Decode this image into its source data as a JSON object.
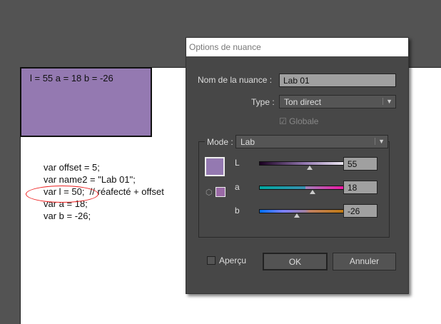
{
  "canvas": {
    "swatch_text": "l = 55 a = 18 b = -26",
    "swatch_color": "#9479b1",
    "code_lines": [
      "var offset = 5;",
      "var name2 = \"Lab 01\";",
      "var l = 50;  // réafecté + offset",
      "var a = 18;",
      "var b = -26;"
    ]
  },
  "dialog": {
    "title": "Options de nuance",
    "name_label": "Nom de la nuance :",
    "name_value": "Lab 01",
    "type_label": "Type :",
    "type_value": "Ton direct",
    "global_label": "Globale",
    "mode_label": "Mode :",
    "mode_value": "Lab",
    "sliders": [
      {
        "label": "L",
        "value": "55",
        "fraction": 0.55
      },
      {
        "label": "a",
        "value": "18",
        "fraction": 0.57
      },
      {
        "label": "b",
        "value": "-26",
        "fraction": 0.4
      }
    ],
    "preview_label": "Aperçu",
    "ok_label": "OK",
    "cancel_label": "Annuler"
  }
}
